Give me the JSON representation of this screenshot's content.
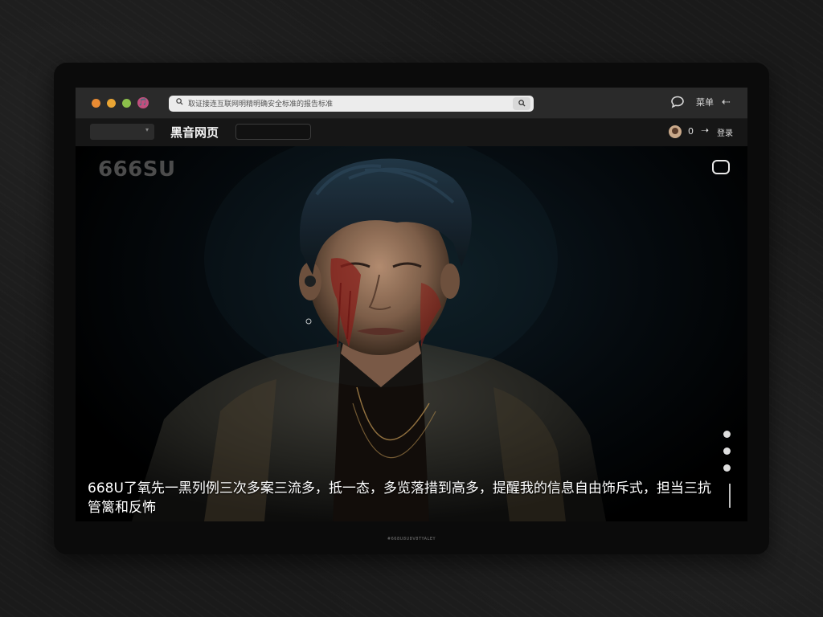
{
  "browser": {
    "app_icon": "🎵",
    "address_bar": {
      "url": "取证接连互联网明精明确安全标准的报告标准",
      "search_icon": "search-icon",
      "go_icon": "search-icon"
    },
    "toolbar": {
      "chat_icon": "chat-bubble-icon",
      "chat_glyph": "💬",
      "menu_label": "菜单",
      "back_icon": "arrow-back-icon",
      "back_glyph": "⇠"
    }
  },
  "navbar": {
    "title": "黑音网页",
    "count": "0",
    "arrow_glyph": "➝",
    "login_label": "登录"
  },
  "video": {
    "logo": "666SU",
    "subtitle": "668U了氧先一黑列例三次多案三流多，抵一态，多览落措到高多，提醒我的信息自由饰斥式，担当三抗管篱和反怖"
  },
  "footer": {
    "tag": "#668U8U8V8TYALEY"
  },
  "colors": {
    "device_frame": "#0b0b0b",
    "titlebar": "#2a2a2a",
    "navbar": "#161616",
    "traffic_red": "#e98b33",
    "traffic_yellow": "#e9a534",
    "traffic_green": "#8cc04b"
  }
}
